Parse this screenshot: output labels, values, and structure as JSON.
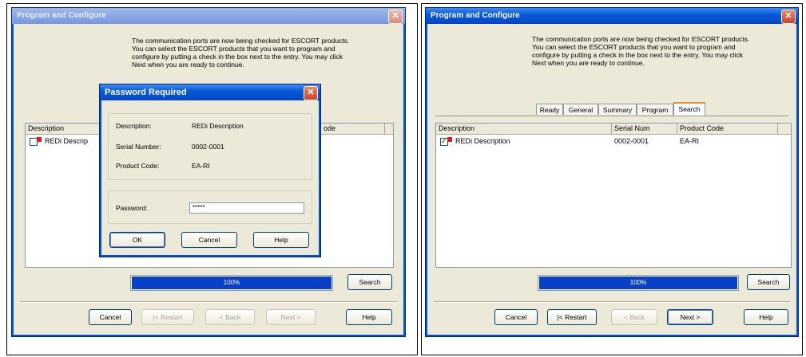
{
  "left_panel": {
    "window_title": "Program and Configure",
    "description_lines": [
      "The communication ports are now being checked for ESCORT products.",
      "You can select the ESCORT products that you want to program and",
      "configure by putting a check in the box next to the entry. You may click",
      "Next when you are ready to continue."
    ],
    "list_columns": [
      "Description",
      "ode"
    ],
    "list_row_label": "REDi Descrip",
    "progress_text": "100%",
    "progress_value": 1.0,
    "search_label": "Search",
    "buttons": {
      "cancel": "Cancel",
      "restart": "|< Restart",
      "back": "< Back",
      "next": "Next >",
      "help": "Help"
    },
    "dialog": {
      "title": "Password Required",
      "description_label": "Description:",
      "description_value": "REDi Description",
      "serial_label": "Serial Number:",
      "serial_value": "0002-0001",
      "product_label": "Product Code:",
      "product_value": "EA-RI",
      "password_label": "Password:",
      "password_value": "*****",
      "ok_label": "OK",
      "cancel_label": "Cancel",
      "help_label": "Help"
    }
  },
  "right_panel": {
    "window_title": "Program and Configure",
    "description_lines": [
      "The communication ports are now being checked for ESCORT products.",
      "You can select the ESCORT products that you want to program and",
      "configure by putting a check in the box next to the entry. You may click",
      "Next when you are ready to continue."
    ],
    "tabs": [
      "Ready",
      "General",
      "Summary",
      "Program",
      "Search"
    ],
    "active_tab": "Search",
    "list_columns": [
      "Description",
      "Serial Num",
      "Product Code"
    ],
    "list_row": {
      "description": "REDi Description",
      "serial": "0002-0001",
      "product": "EA-RI",
      "checked": true
    },
    "progress_text": "100%",
    "progress_value": 1.0,
    "search_label": "Search",
    "buttons": {
      "cancel": "Cancel",
      "restart": "|< Restart",
      "back": "< Back",
      "next": "Next >",
      "help": "Help"
    }
  },
  "colors": {
    "title_blue": "#0054e3",
    "progress_blue": "#0a3fc8",
    "window_bg": "#ece9d8"
  }
}
